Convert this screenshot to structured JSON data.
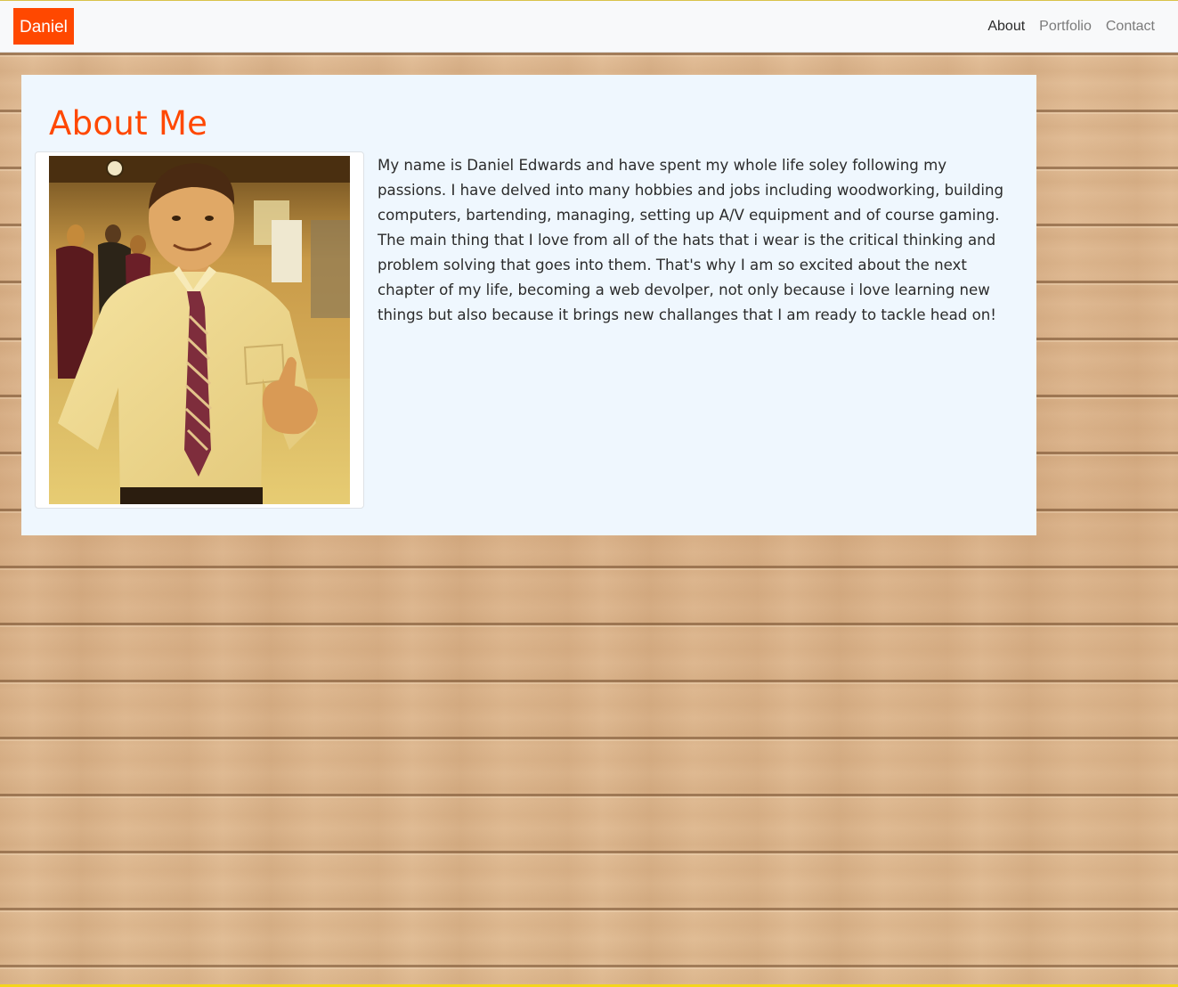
{
  "navbar": {
    "brand": "Daniel",
    "links": [
      {
        "label": "About",
        "active": true
      },
      {
        "label": "Portfolio",
        "active": false
      },
      {
        "label": "Contact",
        "active": false
      }
    ]
  },
  "about": {
    "heading": "About Me",
    "photo_alt": "Daniel Edwards",
    "bio": "My name is Daniel Edwards and have spent my whole life soley following my passions. I have delved into many hobbies and jobs including woodworking, building computers, bartending, managing, setting up A/V equipment and of course gaming. The main thing that I love from all of the hats that i wear is the critical thinking and problem solving that goes into them. That's why I am so excited about the next chapter of my life, becoming a web devolper, not only because i love learning new things but also because it brings new challanges that I am ready to tackle head on!"
  },
  "colors": {
    "accent": "#ff4800",
    "card_background": "#eff7fe",
    "navbar_background": "#f8f9fa"
  }
}
